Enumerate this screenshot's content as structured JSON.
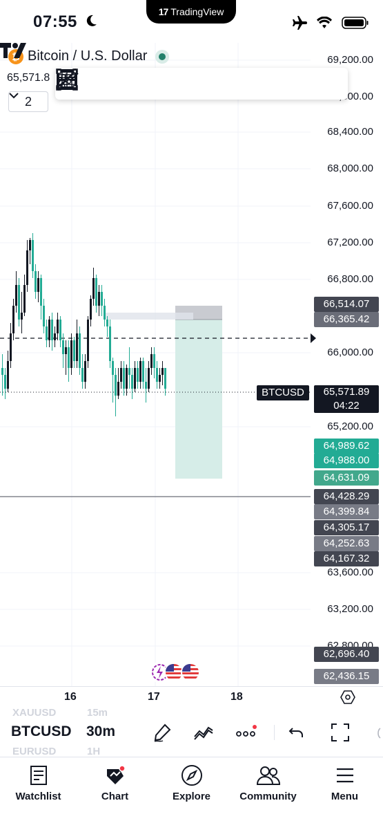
{
  "status_bar": {
    "time": "07:55",
    "app_pill": "TradingView"
  },
  "symbol": {
    "name": "Bitcoin / U.S. Dollar",
    "coin_glyph": "₿",
    "price_short": "65,571.8",
    "collapse_count": "2"
  },
  "drawing_tools": [
    "trend-line-icon",
    "support-line-icon",
    "long-position-line-icon",
    "horizontal-ray-icon",
    "rectangle-icon",
    "path-icon",
    "angle-icon",
    "grid-icon"
  ],
  "price_axis": [
    "69,200.00",
    "68,400.00",
    "68,000.00",
    "67,600.00",
    "67,200.00",
    "66,800.00",
    "66,000.00",
    "65,200.00",
    "63,600.00",
    "63,200.00",
    "62,800.00"
  ],
  "price_axis_partial": "68,800.00",
  "price_tags": [
    {
      "value": "66,514.07",
      "color": "#434651"
    },
    {
      "value": "66,365.42",
      "color": "#6a6d78"
    },
    {
      "value": "64,989.62",
      "color": "#22ab94"
    },
    {
      "value": "64,988.00",
      "color": "#22ab94"
    },
    {
      "value": "64,631.09",
      "color": "#42a88c"
    },
    {
      "value": "64,428.29",
      "color": "#434651"
    },
    {
      "value": "64,399.84",
      "color": "#787b86"
    },
    {
      "value": "64,305.17",
      "color": "#434651"
    },
    {
      "value": "64,252.63",
      "color": "#787b86"
    },
    {
      "value": "64,167.32",
      "color": "#434651"
    },
    {
      "value": "62,696.40",
      "color": "#434651"
    },
    {
      "value": "62,436.15",
      "color": "#787b86"
    }
  ],
  "current": {
    "symbol_tag": "BTCUSD",
    "price": "65,571.89",
    "countdown": "04:22"
  },
  "time_axis": [
    "16",
    "17",
    "18"
  ],
  "symbar": {
    "symbol": "BTCUSD",
    "timeframe": "30m",
    "prev_symbol": "XAUUSD",
    "prev_timeframe": "15m",
    "next_symbol": "EURUSD",
    "next_timeframe": "1H"
  },
  "nav": [
    {
      "label": "Watchlist",
      "icon": "watchlist-icon"
    },
    {
      "label": "Chart",
      "icon": "chart-icon"
    },
    {
      "label": "Explore",
      "icon": "compass-icon"
    },
    {
      "label": "Community",
      "icon": "community-icon"
    },
    {
      "label": "Menu",
      "icon": "menu-icon"
    }
  ],
  "colors": {
    "up_tint": "#d6ede8",
    "tag_dark": "#131722",
    "accent_red": "#f23645"
  }
}
